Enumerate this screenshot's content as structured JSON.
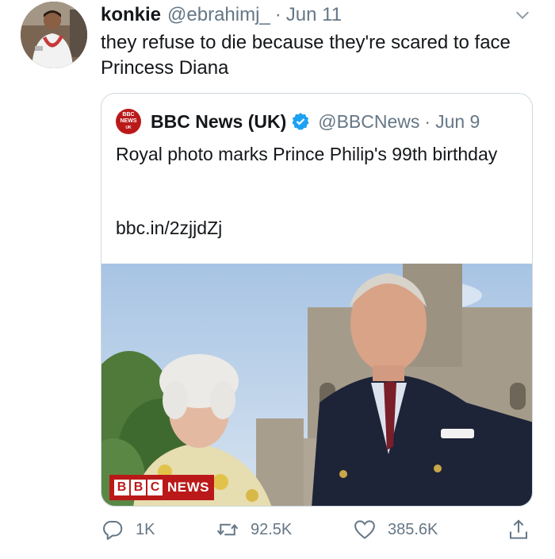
{
  "tweet": {
    "author_name": "konkie",
    "author_handle": "@ebrahimj_",
    "separator": "·",
    "date": "Jun 11",
    "text": "they refuse to die because they're scared to face Princess Diana"
  },
  "quote": {
    "logo_lines": [
      "BBC",
      "NEWS",
      "UK"
    ],
    "author_name": "BBC News (UK)",
    "author_handle": "@BBCNews",
    "separator": "·",
    "date": "Jun 9",
    "text": "Royal photo marks Prince Philip's 99th birthday",
    "link": "bbc.in/2zjjdZj",
    "photo_logo": {
      "letters": [
        "B",
        "B",
        "C"
      ],
      "word": "NEWS"
    }
  },
  "actions": {
    "reply_count": "1K",
    "retweet_count": "92.5K",
    "like_count": "385.6K"
  },
  "colors": {
    "text": "#14171a",
    "secondary": "#657786",
    "verified": "#1da1f2",
    "bbc_red": "#bb1919",
    "border": "#cfd9de"
  },
  "icons": [
    "chevron-down-icon",
    "verified-badge-icon",
    "reply-icon",
    "retweet-icon",
    "like-icon",
    "share-icon"
  ]
}
